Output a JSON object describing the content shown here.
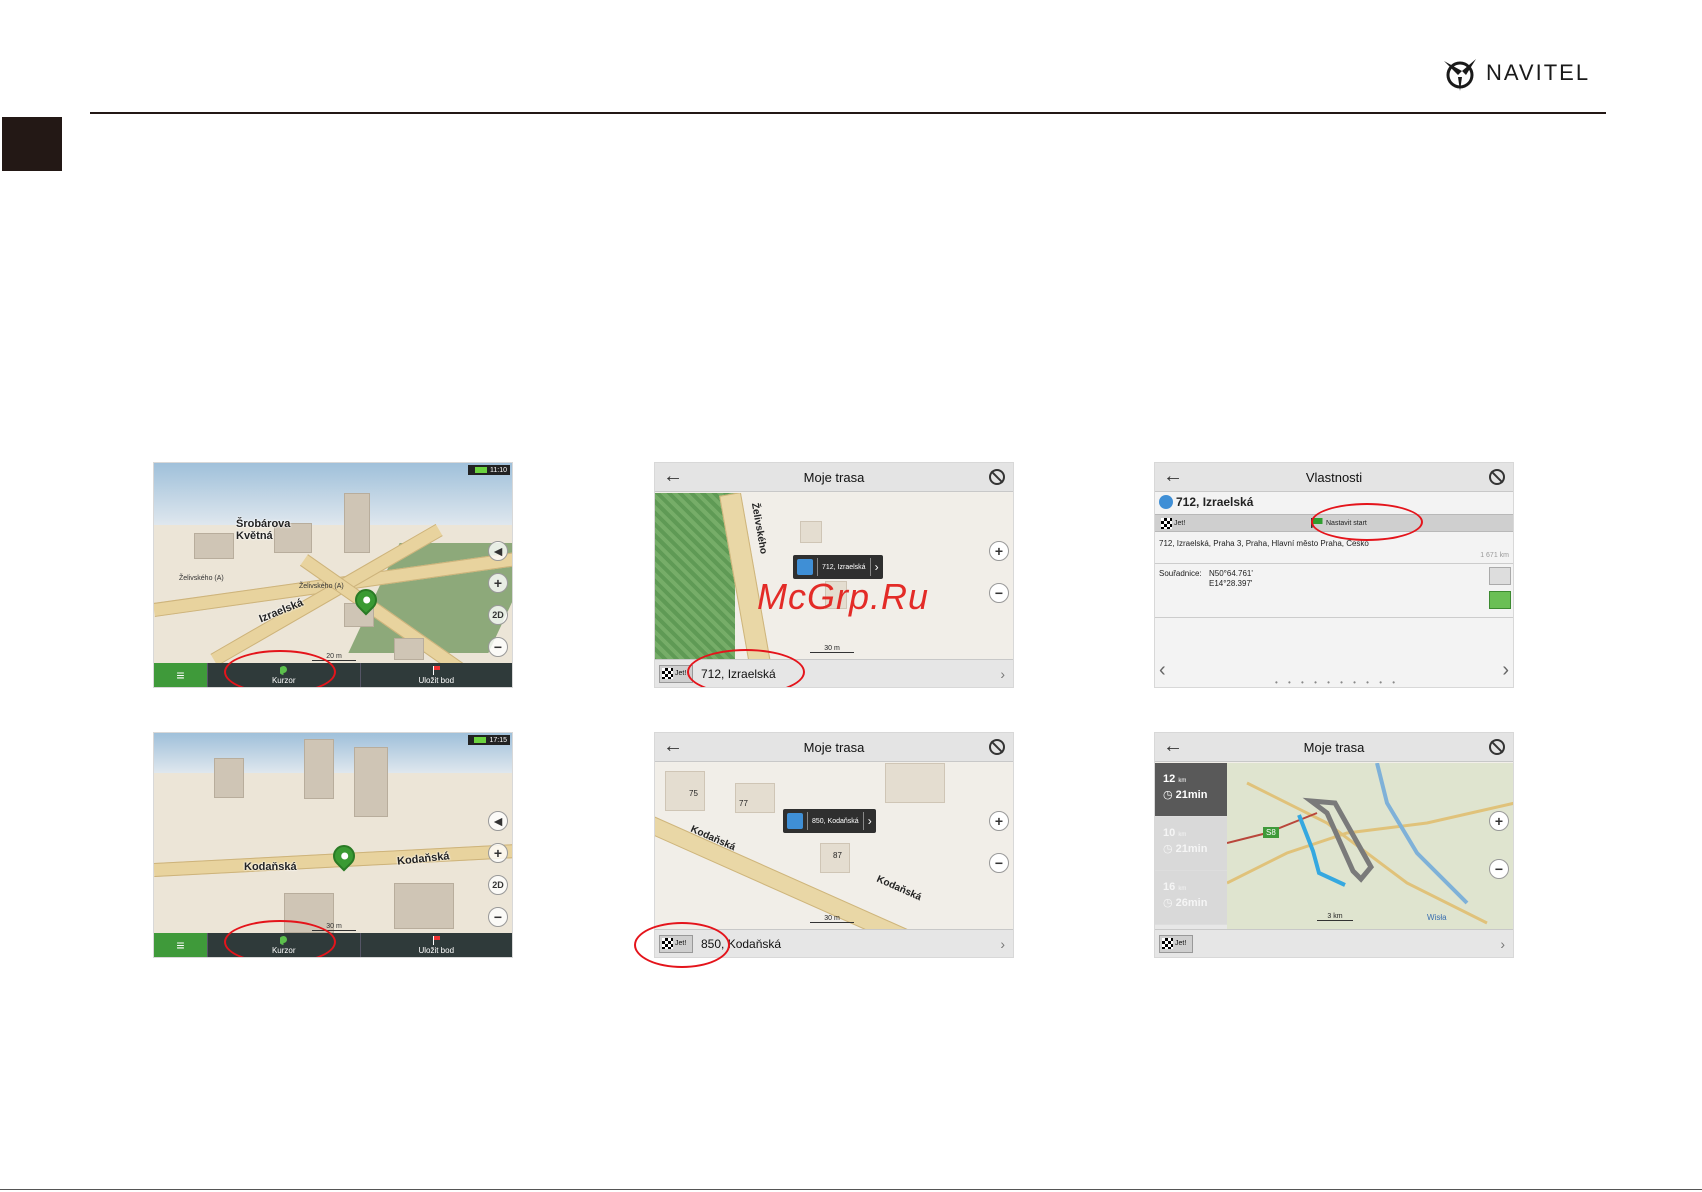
{
  "header": {
    "brand": "NAVITEL"
  },
  "watermark": "McGrp.Ru",
  "screens": {
    "top_left": {
      "time": "11:10",
      "streets": [
        "Šrobárova",
        "Květná",
        "Izraelská",
        "Želivského (A)",
        "Želivského (A)"
      ],
      "scale": "20 m",
      "controls": {
        "mode": "2D"
      },
      "bottom_left": "Kurzor",
      "bottom_right": "Uložit bod"
    },
    "bottom_left": {
      "time": "17:15",
      "streets": [
        "Kodaňská",
        "Kodaňská"
      ],
      "scale": "30 m",
      "controls": {
        "mode": "2D"
      },
      "bottom_left": "Kurzor",
      "bottom_right": "Uložit bod"
    },
    "top_middle": {
      "title": "Moje trasa",
      "street_vertical": "Želivského",
      "callout": "712, Izraelská",
      "scale": "30 m",
      "go_label": "Jet!",
      "address": "712, Izraelská"
    },
    "bottom_middle": {
      "title": "Moje trasa",
      "streets": [
        "Kodaňská",
        "Kodaňská"
      ],
      "building_numbers": [
        "75",
        "77",
        "87"
      ],
      "callout": "850, Kodaňská",
      "scale": "30 m",
      "go_label": "Jet!",
      "address": "850, Kodaňská"
    },
    "top_right": {
      "title": "Vlastnosti",
      "place": "712, Izraelská",
      "go_label": "Jet!",
      "set_start": "Nastavit start",
      "full_address": "712, Izraelská, Praha 3, Praha, Hlavní město Praha, Česko",
      "distance": "1 671 km",
      "coords_label": "Souřadnice:",
      "lat": "N50°64.761'",
      "lon": "E14°28.397'"
    },
    "bottom_right": {
      "title": "Moje trasa",
      "routes": [
        {
          "dist": "12",
          "unit": "km",
          "time": "21min"
        },
        {
          "dist": "10",
          "unit": "km",
          "time": "21min"
        },
        {
          "dist": "16",
          "unit": "km",
          "time": "26min"
        }
      ],
      "road_badge": "S8",
      "scale": "3 km",
      "river_label": "Wisła",
      "go_label": "Jet!"
    }
  },
  "colors": {
    "highlight": "#e4141b",
    "accent_green": "#3f9a3a",
    "watermark": "#e32b27"
  }
}
